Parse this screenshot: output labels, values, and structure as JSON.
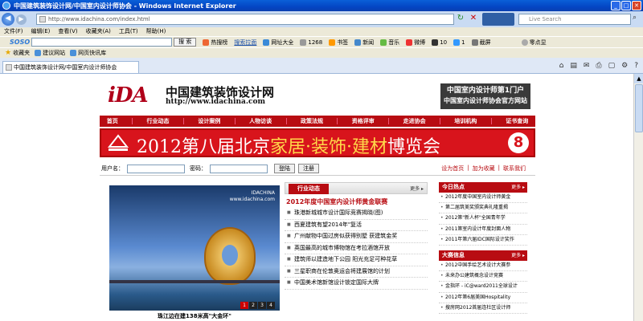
{
  "window": {
    "title": "中国建筑装饰设计网/中国室内设计师协会 - Windows Internet Explorer"
  },
  "address": {
    "url": "http://www.idachina.com/index.html",
    "search_placeholder": "Live Search"
  },
  "menu": {
    "items": [
      "文件(F)",
      "编辑(E)",
      "查看(V)",
      "收藏夹(A)",
      "工具(T)",
      "帮助(H)"
    ]
  },
  "soso": {
    "logo": "SOSO",
    "search_label": "搜 索",
    "items": [
      "热搜榜",
      "搜索拉面",
      "网址大全",
      "1268",
      "书签",
      "新闻",
      "音乐",
      "微博",
      "10",
      "1",
      "截屏",
      "零点显"
    ]
  },
  "favorites": {
    "label": "收藏夹",
    "items": [
      "建议网站",
      "网页快讯库"
    ]
  },
  "tab": {
    "title": "中国建筑装饰设计网/中国室内设计师协会"
  },
  "site": {
    "logo": "iDA",
    "title": "中国建筑装饰设计网",
    "url": "http://www.idachina.com",
    "rbox_line1": "中国室内设计师第1门户",
    "rbox_line2": "中国室内设计师协会官方网站",
    "nav": [
      "首页",
      "行业动态",
      "设计案例",
      "人物访谈",
      "政策法规",
      "资格评审",
      "走进协会",
      "培训机构",
      "证书查询"
    ],
    "banner": {
      "pre": "2012第八届北京",
      "hl": "家居·装饰·建材",
      "post": "博览会",
      "badge": "8"
    },
    "login": {
      "user_label": "用户名：",
      "pass_label": "密码：",
      "login_btn": "登陆",
      "register_btn": "注册",
      "links": [
        "设为首页",
        "|",
        "加为收藏",
        "|",
        "联系我们"
      ]
    },
    "photo": {
      "watermark": "IDACHINA",
      "watermark2": "www.idachina.com",
      "caption": "珠江边在建138米高\"大金环\"",
      "pages": [
        "1",
        "2",
        "3",
        "4"
      ]
    },
    "news": {
      "tab": "行业动态",
      "more": "更多",
      "headline": "2012年度中国室内设计师黄金联赛",
      "items": [
        "珠港新城城市设计国际竞赛揭晓(图)",
        "西夏建筑有望2014年\"复活",
        "广州献物中国过房似获得别墅 获建筑金奖",
        "英国最高的城市博物馆在考拉酒馆开放",
        "建筑师以建造地下公园 阳光充足可种花草",
        "三星职商在伦敦奥运会将建展馆的计划",
        "中国美术馆新馆设计锁定国际大牌"
      ]
    },
    "side1": {
      "title": "今日热点",
      "more": "更多",
      "items": [
        "2012年度中国室内设计师黄金",
        "第二届筑美奖颁奖典礼隆重揭",
        "2012第\"新人杯\"全国青年学",
        "2011第室内设计年度封面人物",
        "2011年第六届IDC国际设计奖作"
      ]
    },
    "side2": {
      "title": "大赛信息",
      "more": "更多",
      "items": [
        "2012中国手绘艺术设计大赛参",
        "未来办公建筑概念设计竞赛",
        "金指环 - iC@ward2011全球设计",
        "2012年第6届美国Hospitality",
        "搜房网2012首届连杜区设计师"
      ]
    }
  }
}
